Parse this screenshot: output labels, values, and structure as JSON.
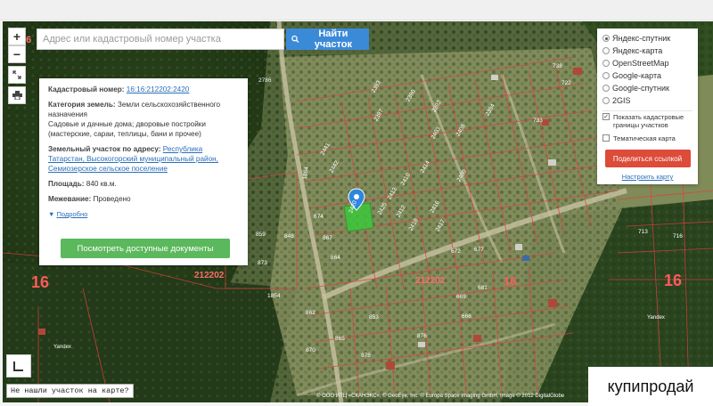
{
  "search": {
    "placeholder": "Адрес или кадастровый номер участка",
    "button_label": "Найти участок"
  },
  "zoom": {
    "in_label": "+",
    "out_label": "−"
  },
  "info_panel": {
    "cadastral_label": "Кадастровый номер:",
    "cadastral_value": "16:16:212202:2420",
    "category_label": "Категория земель:",
    "category_value": "Земли сельскохозяйственного назначения",
    "usage_value": "Садовые и дачные дома; дворовые постройки (мастерские, сараи, теплицы, бани и прочее)",
    "address_label": "Земельный участок по адресу:",
    "address_value": "Республика Татарстан, Высокогорский муниципальный район, Семиозерское сельское поселение",
    "area_label": "Площадь:",
    "area_value": "840 кв.м.",
    "survey_label": "Межевание:",
    "survey_value": "Проведено",
    "more_link": "Подробно",
    "docs_button": "Посмотреть доступные документы"
  },
  "layers": {
    "options": [
      "Яндекс-спутник",
      "Яндекс-карта",
      "OpenStreetMap",
      "Google-карта",
      "Google-спутник",
      "2GIS"
    ],
    "selected": "Яндекс-спутник",
    "show_borders": "Показать кадастровые границы участков",
    "show_borders_checked": true,
    "thematic_map": "Тематическая карта",
    "thematic_checked": false,
    "share_button": "Поделиться ссылкой",
    "setup_link": "Настроить карту"
  },
  "map_labels": {
    "region_numbers": [
      "16",
      "16",
      "16",
      "16"
    ],
    "block_numbers": [
      "212202",
      "212202"
    ],
    "parcel_numbers": [
      "2786",
      "2393",
      "2390",
      "2392",
      "2394",
      "2397",
      "2403",
      "2408",
      "2414",
      "2420",
      "2425",
      "2410",
      "2413",
      "2418",
      "2416",
      "2417",
      "2412",
      "2411",
      "2407",
      "2406",
      "2402",
      "2400",
      "2399",
      "2396",
      "2441",
      "2442",
      "1864",
      "1861",
      "674",
      "867",
      "864",
      "863",
      "869",
      "859",
      "848",
      "847",
      "873",
      "672",
      "677",
      "663",
      "665",
      "669",
      "666",
      "668",
      "670",
      "675",
      "681",
      "689",
      "733",
      "737",
      "738",
      "722",
      "724",
      "721",
      "740",
      "712",
      "713",
      "715",
      "716",
      "726",
      "727",
      "1854",
      "862",
      "866",
      "870",
      "871",
      "865",
      "853",
      "878",
      "876",
      "884",
      "8"
    ]
  },
  "yandex_labels": [
    "Yandex",
    "Yandex"
  ],
  "not_found_link": "Не нашли участок на карте?",
  "copyright": "© ООО ИТЦ «СКАНЭКС», © GeoEye, Inc. © Europa Space Imaging GmbH, Image © 2012 DigitalGlobe",
  "watermark": "купипродай",
  "colors": {
    "primary": "#3b8ad8",
    "success": "#5cb85c",
    "danger": "#dd4b39",
    "parcel_border": "#e04040",
    "selected_parcel": "#3cc83c"
  },
  "icons": [
    "search-icon",
    "fullscreen-icon",
    "print-icon",
    "map-pin-icon",
    "ruler-icon",
    "chevron-down-icon"
  ]
}
